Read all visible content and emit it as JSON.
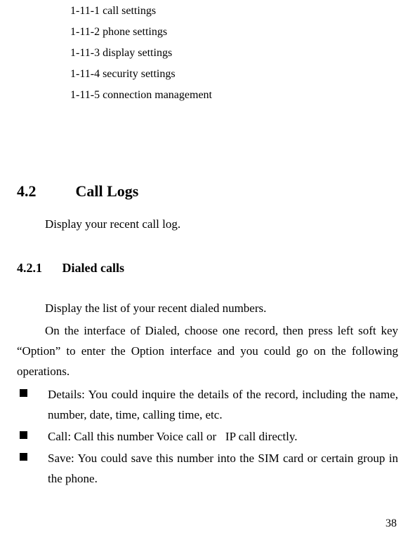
{
  "toc": {
    "items": [
      {
        "label": "1-11-1 call settings"
      },
      {
        "label": "1-11-2 phone settings"
      },
      {
        "label": "1-11-3 display settings"
      },
      {
        "label": "1-11-4 security settings"
      },
      {
        "label": "1-11-5 connection management"
      }
    ]
  },
  "section_4_2": {
    "number": "4.2",
    "title": "Call Logs",
    "intro": "Display your recent call log."
  },
  "section_4_2_1": {
    "number": "4.2.1",
    "title": "Dialed calls",
    "para1": "Display the list of your recent dialed numbers.",
    "para2": "On the interface of Dialed, choose one record, then press left soft key “Option” to enter the Option interface and you could go on the following operations.",
    "bullets": [
      "Details: You could inquire the details of the record, including the name, number, date, time, calling time, etc.",
      "Call: Call this number Voice call or   IP call directly.",
      "Save: You could save this number into the SIM card or certain group in the phone."
    ]
  },
  "page_number": "38"
}
